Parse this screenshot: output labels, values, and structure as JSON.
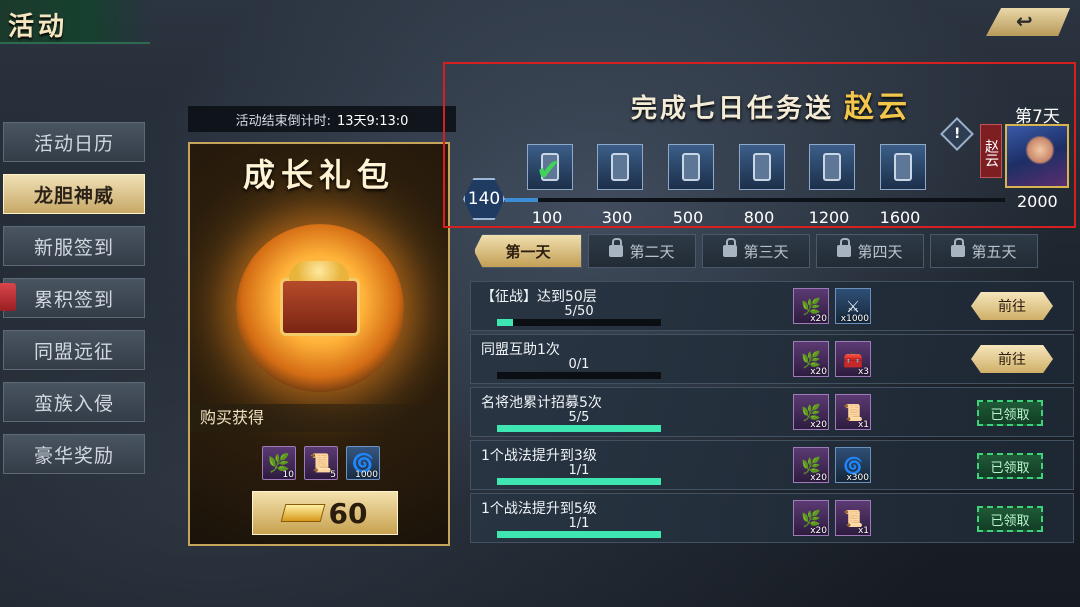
{
  "header": {
    "title": "活动",
    "back_label": "↩"
  },
  "menu": [
    {
      "label": "活动日历",
      "active": false
    },
    {
      "label": "龙胆神威",
      "active": true
    },
    {
      "label": "新服签到",
      "active": false
    },
    {
      "label": "累积签到",
      "active": false
    },
    {
      "label": "同盟远征",
      "active": false
    },
    {
      "label": "蛮族入侵",
      "active": false
    },
    {
      "label": "豪华奖励",
      "active": false
    }
  ],
  "countdown": {
    "label": "活动结束倒计时:",
    "value": "13天9:13:0"
  },
  "pack": {
    "title": "成长礼包",
    "obtain_label": "购买获得",
    "items": [
      {
        "icon": "herb-icon",
        "qty": "10"
      },
      {
        "icon": "scroll-icon",
        "qty": "5"
      },
      {
        "icon": "jade-icon",
        "qty": "1000"
      }
    ],
    "price": "60"
  },
  "mission": {
    "title": "完成七日任务送",
    "hero_name": "赵云",
    "day_label": "第7天",
    "hero_tag": "赵云",
    "hero_points": "2000",
    "current_points": "140",
    "progress_fraction": 0.066,
    "milestones": [
      "100",
      "300",
      "500",
      "800",
      "1200",
      "1600"
    ],
    "claimed": [
      true,
      false,
      false,
      false,
      false,
      false
    ]
  },
  "tabs": [
    {
      "label": "第一天",
      "active": true,
      "locked": false
    },
    {
      "label": "第二天",
      "active": false,
      "locked": true
    },
    {
      "label": "第三天",
      "active": false,
      "locked": true
    },
    {
      "label": "第四天",
      "active": false,
      "locked": true
    },
    {
      "label": "第五天",
      "active": false,
      "locked": true
    }
  ],
  "tasks": [
    {
      "name": "【征战】达到50层",
      "progress": "5/50",
      "fraction": 0.1,
      "rewards": [
        {
          "icon": "herb-icon",
          "qty": "x20"
        },
        {
          "icon": "sword-icon",
          "qty": "x1000"
        }
      ],
      "button": "前往",
      "claimed": false
    },
    {
      "name": "同盟互助1次",
      "progress": "0/1",
      "fraction": 0.0,
      "rewards": [
        {
          "icon": "herb-icon",
          "qty": "x20"
        },
        {
          "icon": "chest-icon",
          "qty": "x3"
        }
      ],
      "button": "前往",
      "claimed": false
    },
    {
      "name": "名将池累计招募5次",
      "progress": "5/5",
      "fraction": 1.0,
      "rewards": [
        {
          "icon": "herb-icon",
          "qty": "x20"
        },
        {
          "icon": "scroll-icon",
          "qty": "x1"
        }
      ],
      "button": "已领取",
      "claimed": true
    },
    {
      "name": "1个战法提升到3级",
      "progress": "1/1",
      "fraction": 1.0,
      "rewards": [
        {
          "icon": "herb-icon",
          "qty": "x20"
        },
        {
          "icon": "jade-icon",
          "qty": "x300"
        }
      ],
      "button": "已领取",
      "claimed": true
    },
    {
      "name": "1个战法提升到5级",
      "progress": "1/1",
      "fraction": 1.0,
      "rewards": [
        {
          "icon": "herb-icon",
          "qty": "x20"
        },
        {
          "icon": "scroll-icon",
          "qty": "x1"
        }
      ],
      "button": "已领取",
      "claimed": true
    }
  ],
  "colors": {
    "accent_gold": "#c7a24f",
    "progress_green": "#3ee6b2",
    "highlight_red": "#d61f1f"
  }
}
